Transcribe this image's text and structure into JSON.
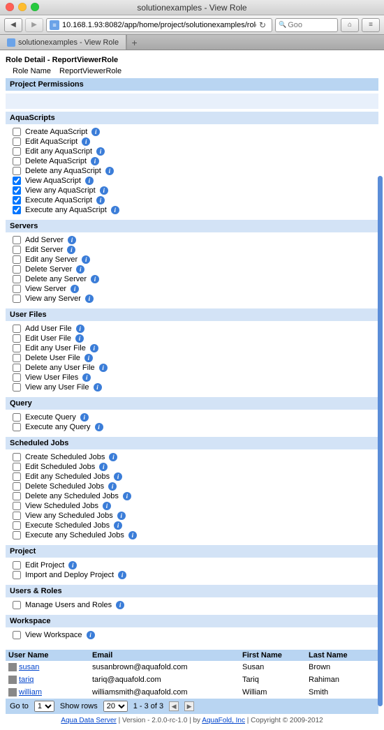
{
  "window": {
    "title": "solutionexamples - View Role"
  },
  "toolbar": {
    "url": "10.168.1.93:8082/app/home/project/solutionexamples/role/ReportViewerRole",
    "search_placeholder": "Goo"
  },
  "tab": {
    "label": "solutionexamples - View Role"
  },
  "detail": {
    "header": "Role Detail - ReportViewerRole",
    "name_label": "Role Name",
    "name_value": "ReportViewerRole"
  },
  "sections": {
    "project_permissions": "Project Permissions",
    "aquascripts": {
      "title": "AquaScripts",
      "items": [
        {
          "label": "Create AquaScript",
          "checked": false
        },
        {
          "label": "Edit AquaScript",
          "checked": false
        },
        {
          "label": "Edit any AquaScript",
          "checked": false
        },
        {
          "label": "Delete AquaScript",
          "checked": false
        },
        {
          "label": "Delete any AquaScript",
          "checked": false
        },
        {
          "label": "View AquaScript",
          "checked": true
        },
        {
          "label": "View any AquaScript",
          "checked": true
        },
        {
          "label": "Execute AquaScript",
          "checked": true
        },
        {
          "label": "Execute any AquaScript",
          "checked": true
        }
      ]
    },
    "servers": {
      "title": "Servers",
      "items": [
        {
          "label": "Add Server",
          "checked": false
        },
        {
          "label": "Edit Server",
          "checked": false
        },
        {
          "label": "Edit any Server",
          "checked": false
        },
        {
          "label": "Delete Server",
          "checked": false
        },
        {
          "label": "Delete any Server",
          "checked": false
        },
        {
          "label": "View Server",
          "checked": false
        },
        {
          "label": "View any Server",
          "checked": false
        }
      ]
    },
    "userfiles": {
      "title": "User Files",
      "items": [
        {
          "label": "Add User File",
          "checked": false
        },
        {
          "label": "Edit User File",
          "checked": false
        },
        {
          "label": "Edit any User File",
          "checked": false
        },
        {
          "label": "Delete User File",
          "checked": false
        },
        {
          "label": "Delete any User File",
          "checked": false
        },
        {
          "label": "View User Files",
          "checked": false
        },
        {
          "label": "View any User File",
          "checked": false
        }
      ]
    },
    "query": {
      "title": "Query",
      "items": [
        {
          "label": "Execute Query",
          "checked": false
        },
        {
          "label": "Execute any Query",
          "checked": false
        }
      ]
    },
    "scheduled": {
      "title": "Scheduled Jobs",
      "items": [
        {
          "label": "Create Scheduled Jobs",
          "checked": false
        },
        {
          "label": "Edit Scheduled Jobs",
          "checked": false
        },
        {
          "label": "Edit any Scheduled Jobs",
          "checked": false
        },
        {
          "label": "Delete Scheduled Jobs",
          "checked": false
        },
        {
          "label": "Delete any Scheduled Jobs",
          "checked": false
        },
        {
          "label": "View Scheduled Jobs",
          "checked": false
        },
        {
          "label": "View any Scheduled Jobs",
          "checked": false
        },
        {
          "label": "Execute Scheduled Jobs",
          "checked": false
        },
        {
          "label": "Execute any Scheduled Jobs",
          "checked": false
        }
      ]
    },
    "project": {
      "title": "Project",
      "items": [
        {
          "label": "Edit Project",
          "checked": false
        },
        {
          "label": "Import and Deploy Project",
          "checked": false
        }
      ]
    },
    "usersroles": {
      "title": "Users & Roles",
      "items": [
        {
          "label": "Manage Users and Roles",
          "checked": false
        }
      ]
    },
    "workspace": {
      "title": "Workspace",
      "items": [
        {
          "label": "View Workspace",
          "checked": false
        }
      ]
    }
  },
  "users": {
    "headers": {
      "user": "User Name",
      "email": "Email",
      "first": "First Name",
      "last": "Last Name"
    },
    "rows": [
      {
        "user": "susan",
        "email": "susanbrown@aquafold.com",
        "first": "Susan",
        "last": "Brown"
      },
      {
        "user": "tariq",
        "email": "tariq@aquafold.com",
        "first": "Tariq",
        "last": "Rahiman"
      },
      {
        "user": "william",
        "email": "williamsmith@aquafold.com",
        "first": "William",
        "last": "Smith"
      }
    ]
  },
  "pager": {
    "goto": "Go to",
    "goto_val": "1",
    "showrows": "Show rows",
    "showrows_val": "20",
    "range": "1 - 3 of 3"
  },
  "footer": {
    "link1": "Aqua Data Server",
    "mid": " | Version - 2.0.0-rc-1.0 | by ",
    "link2": "AquaFold, Inc",
    "end": " | Copyright © 2009-2012"
  }
}
